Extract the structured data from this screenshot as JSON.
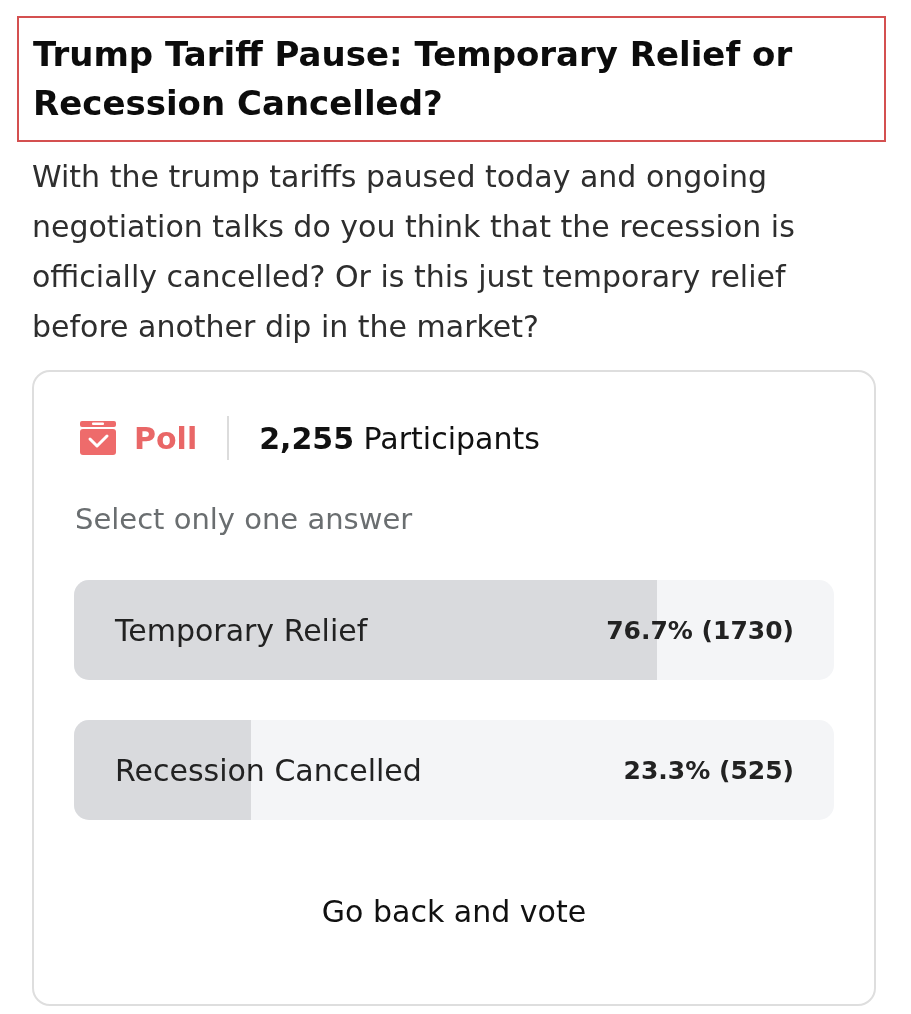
{
  "title": {
    "text": "Trump Tariff Pause: Temporary Relief or Recession Cancelled?",
    "highlighted": true
  },
  "description": "With the trump tariffs paused today and ongoing negotiation talks do you think that the recession is officially cancelled? Or is this just temporary relief before another dip in the market?",
  "poll": {
    "label": "Poll",
    "participants": "**2,255** Participants",
    "instruction": "Select only one answer",
    "options": [
      {
        "label": "Temporary Relief",
        "result": "76.7% (1730)",
        "level": 0.767
      },
      {
        "label": "Recession Cancelled",
        "result": "23.3% (525)",
        "level": 0.233
      }
    ],
    "action": "Go back and vote"
  }
}
